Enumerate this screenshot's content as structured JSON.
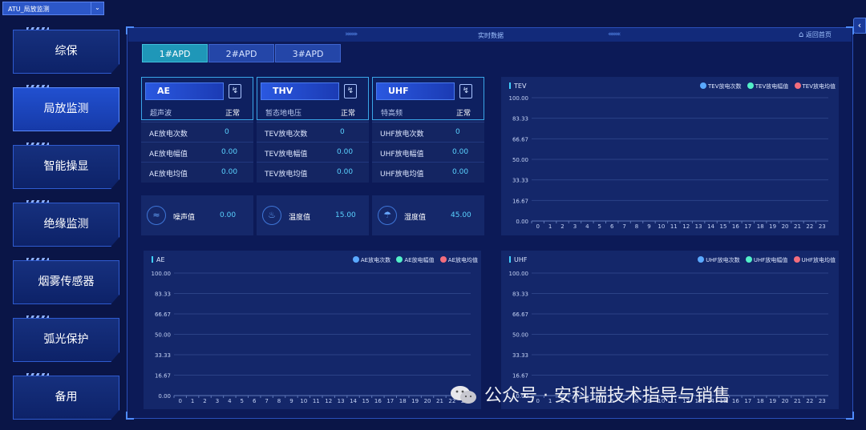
{
  "window_select": {
    "value": "ATU_局放监测"
  },
  "sidebar": {
    "items": [
      {
        "label": "综保"
      },
      {
        "label": "局放监测"
      },
      {
        "label": "智能操显"
      },
      {
        "label": "绝缘监测"
      },
      {
        "label": "烟雾传感器"
      },
      {
        "label": "弧光保护"
      },
      {
        "label": "备用"
      }
    ],
    "active_index": 1
  },
  "header": {
    "title": "实时数据",
    "back_label": "返回首页"
  },
  "tabs": [
    {
      "label": "1#APD"
    },
    {
      "label": "2#APD"
    },
    {
      "label": "3#APD"
    }
  ],
  "sensors": [
    {
      "name": "AE",
      "sub": "超声波",
      "status": "正常",
      "rows": [
        {
          "label": "AE放电次数",
          "value": "0"
        },
        {
          "label": "AE放电幅值",
          "value": "0.00"
        },
        {
          "label": "AE放电均值",
          "value": "0.00"
        }
      ]
    },
    {
      "name": "THV",
      "sub": "暂态地电压",
      "status": "正常",
      "rows": [
        {
          "label": "TEV放电次数",
          "value": "0"
        },
        {
          "label": "TEV放电幅值",
          "value": "0.00"
        },
        {
          "label": "TEV放电均值",
          "value": "0.00"
        }
      ]
    },
    {
      "name": "UHF",
      "sub": "特高频",
      "status": "正常",
      "rows": [
        {
          "label": "UHF放电次数",
          "value": "0"
        },
        {
          "label": "UHF放电幅值",
          "value": "0.00"
        },
        {
          "label": "UHF放电均值",
          "value": "0.00"
        }
      ]
    }
  ],
  "environment": [
    {
      "label": "噪声值",
      "value": "0.00"
    },
    {
      "label": "温度值",
      "value": "15.00"
    },
    {
      "label": "湿度值",
      "value": "45.00"
    }
  ],
  "colors": {
    "legend_count": "#5aa9ff",
    "legend_amplitude": "#52f0c8",
    "legend_mean": "#f26d7d",
    "accent": "#40d0ff"
  },
  "chart_data": [
    {
      "type": "line",
      "title": "TEV",
      "x": [
        "0",
        "1",
        "2",
        "3",
        "4",
        "5",
        "6",
        "7",
        "8",
        "9",
        "10",
        "11",
        "12",
        "13",
        "14",
        "15",
        "16",
        "17",
        "18",
        "19",
        "20",
        "21",
        "22",
        "23"
      ],
      "ylim": [
        0,
        100
      ],
      "yticks": [
        "100.00",
        "83.33",
        "66.67",
        "50.00",
        "33.33",
        "16.67",
        "0.00"
      ],
      "legend": [
        "TEV放电次数",
        "TEV放电幅值",
        "TEV放电均值"
      ],
      "series": [],
      "grid": true,
      "legend_position": "top-right"
    },
    {
      "type": "line",
      "title": "AE",
      "x": [
        "0",
        "1",
        "2",
        "3",
        "4",
        "5",
        "6",
        "7",
        "8",
        "9",
        "10",
        "11",
        "12",
        "13",
        "14",
        "15",
        "16",
        "17",
        "18",
        "19",
        "20",
        "21",
        "22",
        "23"
      ],
      "ylim": [
        0,
        100
      ],
      "yticks": [
        "100.00",
        "83.33",
        "66.67",
        "50.00",
        "33.33",
        "16.67",
        "0.00"
      ],
      "legend": [
        "AE放电次数",
        "AE放电幅值",
        "AE放电均值"
      ],
      "series": [],
      "grid": true,
      "legend_position": "top-right"
    },
    {
      "type": "line",
      "title": "UHF",
      "x": [
        "0",
        "1",
        "2",
        "3",
        "4",
        "5",
        "6",
        "7",
        "8",
        "9",
        "10",
        "11",
        "12",
        "13",
        "14",
        "15",
        "16",
        "17",
        "18",
        "19",
        "20",
        "21",
        "22",
        "23"
      ],
      "ylim": [
        0,
        100
      ],
      "yticks": [
        "100.00",
        "83.33",
        "66.67",
        "50.00",
        "33.33",
        "16.67",
        "0.00"
      ],
      "legend": [
        "UHF放电次数",
        "UHF放电幅值",
        "UHF放电均值"
      ],
      "series": [],
      "grid": true,
      "legend_position": "top-right"
    }
  ],
  "watermark": {
    "text": "公众号 · 安科瑞技术指导与销售"
  }
}
